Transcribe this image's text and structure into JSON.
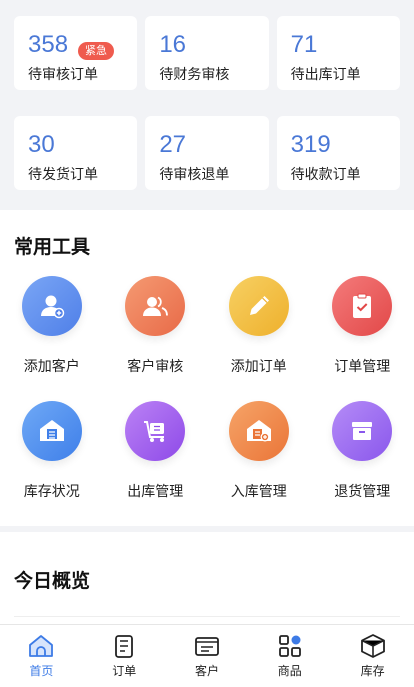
{
  "stats": [
    {
      "value": "358",
      "label": "待审核订单",
      "badge": "紧急"
    },
    {
      "value": "16",
      "label": "待财务审核"
    },
    {
      "value": "71",
      "label": "待出库订单"
    },
    {
      "value": "30",
      "label": "待发货订单"
    },
    {
      "value": "27",
      "label": "待审核退单"
    },
    {
      "value": "319",
      "label": "待收款订单"
    }
  ],
  "tools": {
    "title": "常用工具",
    "items": [
      {
        "label": "添加客户",
        "icon": "add-customer-icon",
        "color": "#5b8def"
      },
      {
        "label": "客户审核",
        "icon": "customer-review-icon",
        "color": "#ef7a57"
      },
      {
        "label": "添加订单",
        "icon": "pencil-icon",
        "color": "#f2bb3b"
      },
      {
        "label": "订单管理",
        "icon": "clipboard-check-icon",
        "color": "#ec5a5a"
      },
      {
        "label": "库存状况",
        "icon": "warehouse-icon",
        "color": "#4d8ff0"
      },
      {
        "label": "出库管理",
        "icon": "cart-icon",
        "color": "#a75cf0"
      },
      {
        "label": "入库管理",
        "icon": "warehouse-in-icon",
        "color": "#f08a45"
      },
      {
        "label": "退货管理",
        "icon": "box-icon",
        "color": "#9e6ef0"
      }
    ]
  },
  "overview": {
    "title": "今日概览"
  },
  "tabbar": [
    {
      "label": "首页",
      "icon": "home-icon",
      "active": true
    },
    {
      "label": "订单",
      "icon": "order-icon"
    },
    {
      "label": "客户",
      "icon": "customer-icon"
    },
    {
      "label": "商品",
      "icon": "goods-icon"
    },
    {
      "label": "库存",
      "icon": "inventory-icon"
    }
  ],
  "colors": {
    "accent": "#3d7be6",
    "number": "#4a78d6",
    "badge": "#ef5b4e"
  }
}
